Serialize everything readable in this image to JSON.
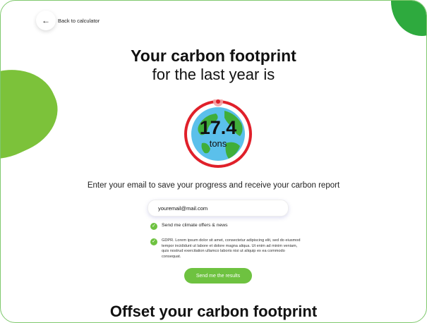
{
  "nav": {
    "back_label": "Back to calculator",
    "back_icon": "arrow-left-icon"
  },
  "hero": {
    "title": "Your carbon footprint",
    "subtitle": "for the last year is"
  },
  "result": {
    "value": "17.4",
    "unit": "tons"
  },
  "email_section": {
    "prompt": "Enter your email to save your progress and receive your carbon report",
    "email_value": "youremail@mail.com",
    "checkbox_offers": "Send me climate offers & news",
    "checkbox_gdpr": "GDPR. Lorem ipsum dolor sit amet, consectetur adipiscing elit, sed do eiusmod tempor incididunt ut labore et dolore magna aliqua. Ut enim ad minim veniam, quis nostrud exercitation ullamco laboris nisi ut aliquip ex ea commodo consequat.",
    "submit_label": "Send me the results"
  },
  "offset": {
    "title": "Offset your carbon footprint"
  },
  "colors": {
    "accent_green": "#6ec240",
    "ring_red": "#e0202a",
    "ocean": "#5bc0eb",
    "land": "#3fae3a"
  }
}
